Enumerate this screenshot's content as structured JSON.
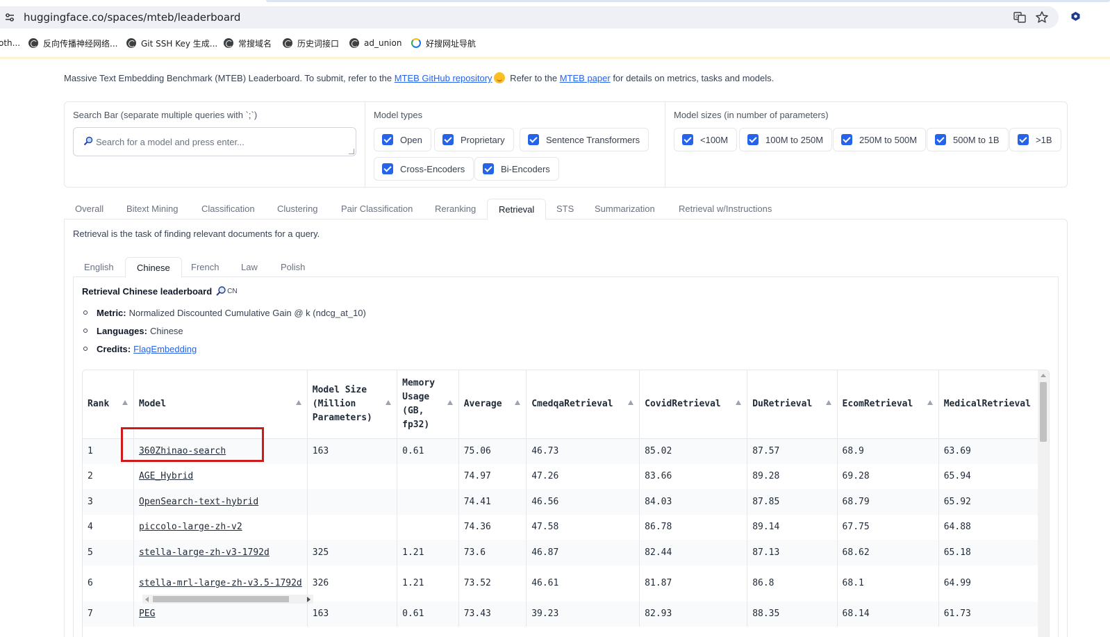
{
  "browser": {
    "url": "huggingface.co/spaces/mteb/leaderboard",
    "bookmarks": [
      {
        "label": "oth..."
      },
      {
        "label": "反向传播神经网络..."
      },
      {
        "label": "Git SSH Key 生成..."
      },
      {
        "label": "常搜域名"
      },
      {
        "label": "历史词接口"
      },
      {
        "label": "ad_union"
      },
      {
        "label": "好搜网址导航"
      }
    ]
  },
  "intro": {
    "text_before": "Massive Text Embedding Benchmark (MTEB) Leaderboard. To submit, refer to the ",
    "github_link": "MTEB GitHub repository",
    "text_middle": " Refer to the ",
    "paper_link": "MTEB paper",
    "text_after": " for details on metrics, tasks and models."
  },
  "filters": {
    "search_label": "Search Bar (separate multiple queries with `;`)",
    "search_placeholder": "Search for a model and press enter...",
    "search_value": "",
    "model_types_label": "Model types",
    "model_types": [
      "Open",
      "Proprietary",
      "Sentence Transformers",
      "Cross-Encoders",
      "Bi-Encoders"
    ],
    "model_sizes_label": "Model sizes (in number of parameters)",
    "model_sizes": [
      "<100M",
      "100M to 250M",
      "250M to 500M",
      "500M to 1B",
      ">1B"
    ]
  },
  "tabs": [
    "Overall",
    "Bitext Mining",
    "Classification",
    "Clustering",
    "Pair Classification",
    "Reranking",
    "Retrieval",
    "STS",
    "Summarization",
    "Retrieval w/Instructions"
  ],
  "active_tab": "Retrieval",
  "panel_description": "Retrieval is the task of finding relevant documents for a query.",
  "subtabs": [
    "English",
    "Chinese",
    "French",
    "Law",
    "Polish"
  ],
  "active_subtab": "Chinese",
  "leaderboard": {
    "title": "Retrieval Chinese leaderboard",
    "flag_text": "CN",
    "metric_label": "Metric:",
    "metric_value": "Normalized Discounted Cumulative Gain @ k (ndcg_at_10)",
    "languages_label": "Languages:",
    "languages_value": "Chinese",
    "credits_label": "Credits:",
    "credits_link": "FlagEmbedding"
  },
  "table": {
    "columns": [
      "Rank",
      "Model",
      "Model Size (Million Parameters)",
      "Memory Usage (GB, fp32)",
      "Average",
      "CmedqaRetrieval",
      "CovidRetrieval",
      "DuRetrieval",
      "EcomRetrieval",
      "MedicalRetrieval"
    ],
    "rows": [
      [
        "1",
        "360Zhinao-search",
        "163",
        "0.61",
        "75.06",
        "46.73",
        "85.02",
        "87.57",
        "68.9",
        "63.69"
      ],
      [
        "2",
        "AGE_Hybrid",
        "",
        "",
        "74.97",
        "47.26",
        "83.66",
        "89.28",
        "69.28",
        "65.94"
      ],
      [
        "3",
        "OpenSearch-text-hybrid",
        "",
        "",
        "74.41",
        "46.56",
        "84.03",
        "87.85",
        "68.79",
        "65.92"
      ],
      [
        "4",
        "piccolo-large-zh-v2",
        "",
        "",
        "74.36",
        "47.58",
        "86.78",
        "89.14",
        "67.75",
        "64.88"
      ],
      [
        "5",
        "stella-large-zh-v3-1792d",
        "325",
        "1.21",
        "73.6",
        "46.87",
        "82.44",
        "87.13",
        "68.62",
        "65.18"
      ],
      [
        "6",
        "stella-mrl-large-zh-v3.5-1792d",
        "326",
        "1.21",
        "73.52",
        "46.61",
        "81.87",
        "86.8",
        "68.1",
        "64.99"
      ],
      [
        "7",
        "PEG",
        "163",
        "0.61",
        "73.43",
        "39.23",
        "82.93",
        "88.35",
        "68.14",
        "61.73"
      ]
    ]
  },
  "colors": {
    "accent": "#2563eb",
    "highlight": "#cc1b1b",
    "border": "#e5e7eb"
  }
}
